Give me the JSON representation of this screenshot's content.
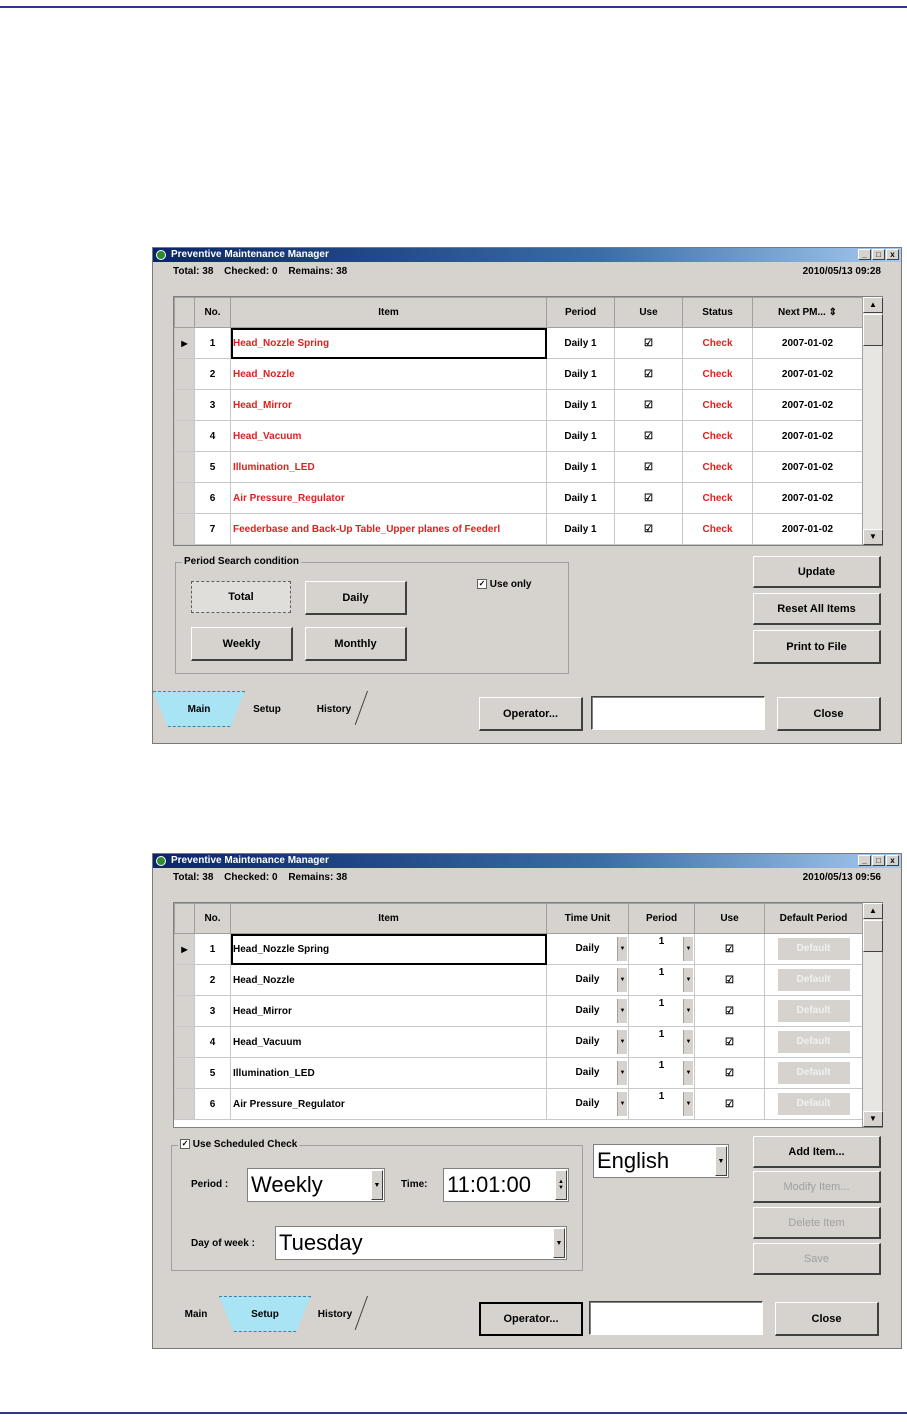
{
  "colors": {
    "page_rule": "#2a3a8c",
    "check_red": "#e02020",
    "active_tab": "#a8e4f4"
  },
  "window1": {
    "title": "Preventive Maintenance Manager",
    "window_controls": [
      "_",
      "□",
      "x"
    ],
    "counts": {
      "total": "Total: 38",
      "checked": "Checked: 0",
      "remains": "Remains: 38"
    },
    "datetime": "2010/05/13 09:28",
    "columns": [
      "No.",
      "Item",
      "Period",
      "Use",
      "Status",
      "Next PM..."
    ],
    "rows": [
      {
        "no": "1",
        "item": "Head_Nozzle Spring",
        "period": "Daily 1",
        "use": "☑",
        "status": "Check",
        "next": "2007-01-02"
      },
      {
        "no": "2",
        "item": "Head_Nozzle",
        "period": "Daily 1",
        "use": "☑",
        "status": "Check",
        "next": "2007-01-02"
      },
      {
        "no": "3",
        "item": "Head_Mirror",
        "period": "Daily 1",
        "use": "☑",
        "status": "Check",
        "next": "2007-01-02"
      },
      {
        "no": "4",
        "item": "Head_Vacuum",
        "period": "Daily 1",
        "use": "☑",
        "status": "Check",
        "next": "2007-01-02"
      },
      {
        "no": "5",
        "item": "Illumination_LED",
        "period": "Daily 1",
        "use": "☑",
        "status": "Check",
        "next": "2007-01-02"
      },
      {
        "no": "6",
        "item": "Air Pressure_Regulator",
        "period": "Daily 1",
        "use": "☑",
        "status": "Check",
        "next": "2007-01-02"
      },
      {
        "no": "7",
        "item": "Feederbase and Back-Up Table_Upper planes of Feederl",
        "period": "Daily 1",
        "use": "☑",
        "status": "Check",
        "next": "2007-01-02"
      }
    ],
    "search_group": {
      "legend": "Period Search condition",
      "use_only": "Use only",
      "buttons": {
        "total": "Total",
        "daily": "Daily",
        "weekly": "Weekly",
        "monthly": "Monthly"
      }
    },
    "side_buttons": {
      "update": "Update",
      "reset": "Reset All Items",
      "print": "Print to File"
    },
    "tabs": {
      "main": "Main",
      "setup": "Setup",
      "history": "History"
    },
    "operator": "Operator...",
    "close": "Close"
  },
  "window2": {
    "title": "Preventive Maintenance Manager",
    "window_controls": [
      "_",
      "□",
      "x"
    ],
    "counts": {
      "total": "Total: 38",
      "checked": "Checked: 0",
      "remains": "Remains: 38"
    },
    "datetime": "2010/05/13 09:56",
    "columns": [
      "No.",
      "Item",
      "Time Unit",
      "Period",
      "Use",
      "Default Period"
    ],
    "rows": [
      {
        "no": "1",
        "item": "Head_Nozzle Spring",
        "unit": "Daily",
        "period": "1",
        "use": "☑",
        "default": "Default"
      },
      {
        "no": "2",
        "item": "Head_Nozzle",
        "unit": "Daily",
        "period": "1",
        "use": "☑",
        "default": "Default"
      },
      {
        "no": "3",
        "item": "Head_Mirror",
        "unit": "Daily",
        "period": "1",
        "use": "☑",
        "default": "Default"
      },
      {
        "no": "4",
        "item": "Head_Vacuum",
        "unit": "Daily",
        "period": "1",
        "use": "☑",
        "default": "Default"
      },
      {
        "no": "5",
        "item": "Illumination_LED",
        "unit": "Daily",
        "period": "1",
        "use": "☑",
        "default": "Default"
      },
      {
        "no": "6",
        "item": "Air Pressure_Regulator",
        "unit": "Daily",
        "period": "1",
        "use": "☑",
        "default": "Default"
      }
    ],
    "schedule": {
      "legend": "Use Scheduled Check",
      "period_label": "Period :",
      "period_value": "Weekly",
      "time_label": "Time:",
      "time_value": "11:01:00",
      "dow_label": "Day of week :",
      "dow_value": "Tuesday"
    },
    "language": "English",
    "side_buttons": {
      "add": "Add Item...",
      "modify": "Modify Item...",
      "delete": "Delete Item",
      "save": "Save"
    },
    "tabs": {
      "main": "Main",
      "setup": "Setup",
      "history": "History"
    },
    "operator": "Operator...",
    "close": "Close"
  }
}
